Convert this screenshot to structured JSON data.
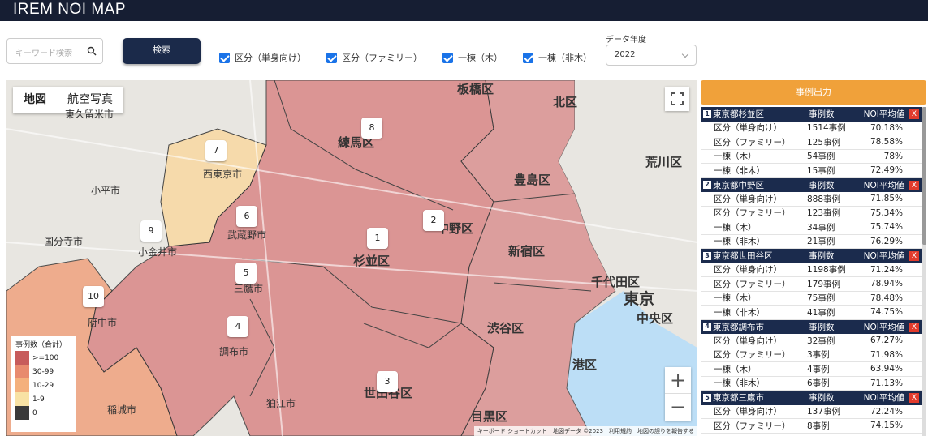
{
  "app": {
    "title": "IREM NOI MAP"
  },
  "search": {
    "placeholder": "キーワード検索",
    "button_label": "検索"
  },
  "filters": [
    {
      "label": "区分（単身向け）",
      "checked": true
    },
    {
      "label": "区分（ファミリー）",
      "checked": true
    },
    {
      "label": "一棟（木）",
      "checked": true
    },
    {
      "label": "一棟（非木）",
      "checked": true
    }
  ],
  "year": {
    "label": "データ年度",
    "selected": "2022"
  },
  "map": {
    "tabs": [
      "地図",
      "航空写真"
    ],
    "active_tab": "地図",
    "markers": [
      "1",
      "2",
      "3",
      "4",
      "5",
      "6",
      "7",
      "8",
      "9",
      "10"
    ],
    "places": [
      "練馬区",
      "杉並区",
      "中野区",
      "新宿区",
      "渋谷区",
      "世田谷区",
      "目黒区",
      "港区",
      "千代田区",
      "中央区",
      "東京",
      "豊島区",
      "北区",
      "荒川区",
      "板橋区",
      "武蔵野市",
      "三鷹市",
      "調布市",
      "府中市",
      "小金井市",
      "西東京市",
      "小平市",
      "国分寺市",
      "狛江市",
      "稲城市",
      "東久留米市"
    ],
    "legend": {
      "title": "事例数（合計）",
      "items": [
        {
          "label": ">=100",
          "color": "#c75b5b"
        },
        {
          "label": "30-99",
          "color": "#e88a6e"
        },
        {
          "label": "10-29",
          "color": "#f4b07c"
        },
        {
          "label": "1-9",
          "color": "#f8e2a4"
        },
        {
          "label": "0",
          "color": "#3a3a3a"
        }
      ]
    },
    "attribution": "キーボード ショートカット　地図データ ©2023　利用規約　地図の誤りを報告する",
    "zoom_in": "+",
    "zoom_out": "−"
  },
  "panel": {
    "export_label": "事例出力",
    "col_count": "事例数",
    "col_avg": "NOI平均値",
    "groups": [
      {
        "num": "1",
        "name": "東京都杉並区",
        "rows": [
          {
            "label": "区分（単身向け）",
            "count": "1514事例",
            "avg": "70.18%"
          },
          {
            "label": "区分（ファミリー）",
            "count": "125事例",
            "avg": "78.58%"
          },
          {
            "label": "一棟（木）",
            "count": "54事例",
            "avg": "78%"
          },
          {
            "label": "一棟（非木）",
            "count": "15事例",
            "avg": "72.49%"
          }
        ]
      },
      {
        "num": "2",
        "name": "東京都中野区",
        "rows": [
          {
            "label": "区分（単身向け）",
            "count": "888事例",
            "avg": "71.85%"
          },
          {
            "label": "区分（ファミリー）",
            "count": "123事例",
            "avg": "75.34%"
          },
          {
            "label": "一棟（木）",
            "count": "34事例",
            "avg": "75.74%"
          },
          {
            "label": "一棟（非木）",
            "count": "21事例",
            "avg": "76.29%"
          }
        ]
      },
      {
        "num": "3",
        "name": "東京都世田谷区",
        "rows": [
          {
            "label": "区分（単身向け）",
            "count": "1198事例",
            "avg": "71.24%"
          },
          {
            "label": "区分（ファミリー）",
            "count": "179事例",
            "avg": "78.94%"
          },
          {
            "label": "一棟（木）",
            "count": "75事例",
            "avg": "78.48%"
          },
          {
            "label": "一棟（非木）",
            "count": "41事例",
            "avg": "74.75%"
          }
        ]
      },
      {
        "num": "4",
        "name": "東京都調布市",
        "rows": [
          {
            "label": "区分（単身向け）",
            "count": "32事例",
            "avg": "67.27%"
          },
          {
            "label": "区分（ファミリー）",
            "count": "3事例",
            "avg": "71.98%"
          },
          {
            "label": "一棟（木）",
            "count": "4事例",
            "avg": "63.94%"
          },
          {
            "label": "一棟（非木）",
            "count": "6事例",
            "avg": "71.13%"
          }
        ]
      },
      {
        "num": "5",
        "name": "東京都三鷹市",
        "rows": [
          {
            "label": "区分（単身向け）",
            "count": "137事例",
            "avg": "72.24%"
          },
          {
            "label": "区分（ファミリー）",
            "count": "8事例",
            "avg": "74.15%"
          }
        ]
      }
    ]
  }
}
